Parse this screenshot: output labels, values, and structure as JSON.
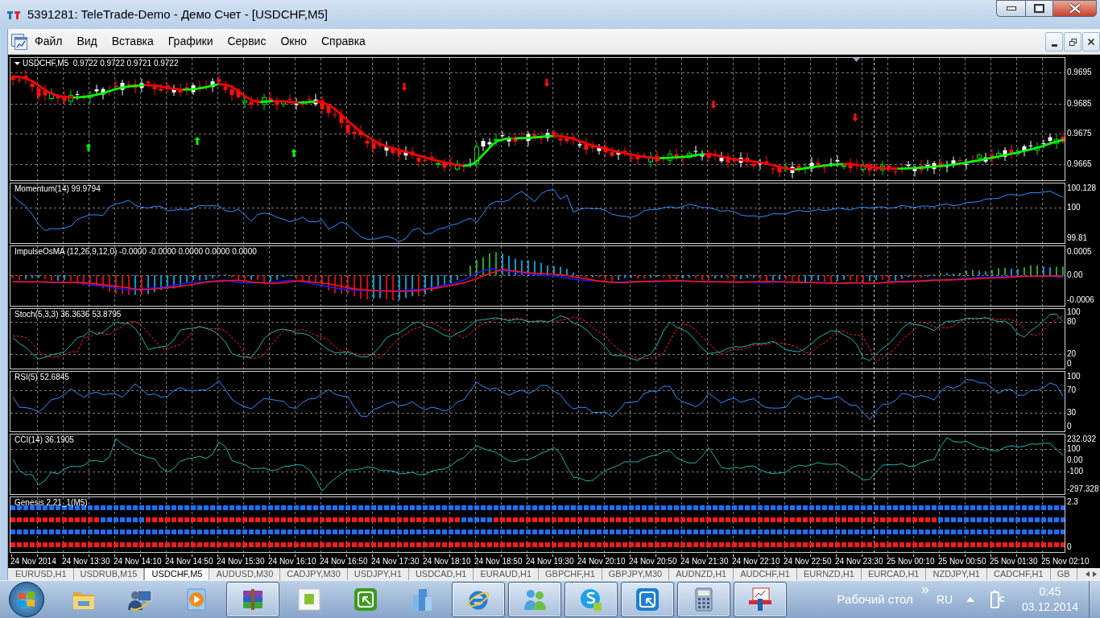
{
  "window": {
    "title": "5391281: TeleTrade-Demo - Демо Счет - [USDCHF,M5]"
  },
  "menu": [
    "Файл",
    "Вид",
    "Вставка",
    "Графики",
    "Сервис",
    "Окно",
    "Справка"
  ],
  "chart": {
    "panes": [
      {
        "kind": "candles",
        "legend": "USDCHF,M5  0.9722 0.9722 0.9721 0.9722",
        "axis_labels": [
          "0.9695",
          "0.9685",
          "0.9675",
          "0.9665"
        ]
      },
      {
        "kind": "line",
        "legend": "Momentum(14) 99.9794",
        "axis_labels": [
          "100.128",
          "100",
          "99.81"
        ]
      },
      {
        "kind": "histogram",
        "legend": "ImpulseOsMA (12,26,9,12,0) -0.0000 -0.0000 0.0000 0.0000 0.0000",
        "axis_labels": [
          "0.0005",
          "0.00",
          "-0.0006"
        ]
      },
      {
        "kind": "oscillator",
        "legend": "Stoch(5,3,3) 36.3636 53.8795",
        "axis_labels": [
          "100",
          "80",
          "20",
          "0"
        ]
      },
      {
        "kind": "line",
        "legend": "RSI(5) 52.6845",
        "axis_labels": [
          "100",
          "70",
          "30",
          "0"
        ]
      },
      {
        "kind": "line",
        "legend": "CCI(14) 36.1905",
        "axis_labels": [
          "232.032",
          "100",
          "0.00",
          "-100",
          "-297.328"
        ]
      },
      {
        "kind": "dots",
        "legend": "Genesis 2.21_1(M5)",
        "axis_labels": [
          "2.3",
          "0"
        ]
      }
    ],
    "time_labels": [
      "24 Nov 2014",
      "24 Nov 13:30",
      "24 Nov 14:10",
      "24 Nov 14:50",
      "24 Nov 15:30",
      "24 Nov 16:10",
      "24 Nov 16:50",
      "24 Nov 17:30",
      "24 Nov 18:10",
      "24 Nov 18:50",
      "24 Nov 19:30",
      "24 Nov 20:10",
      "24 Nov 20:50",
      "24 Nov 21:30",
      "24 Nov 22:10",
      "24 Nov 22:50",
      "24 Nov 23:30",
      "25 Nov 00:10",
      "25 Nov 00:50",
      "25 Nov 01:30",
      "25 Nov 02:10"
    ]
  },
  "tabs": [
    {
      "label": "EURUSD,H1",
      "selected": false
    },
    {
      "label": "USDRUB,M15",
      "selected": false
    },
    {
      "label": "USDCHF,M5",
      "selected": true
    },
    {
      "label": "AUDUSD,M30",
      "selected": false
    },
    {
      "label": "CADJPY,M30",
      "selected": false
    },
    {
      "label": "USDJPY,H1",
      "selected": false
    },
    {
      "label": "USDCAD,H1",
      "selected": false
    },
    {
      "label": "EURAUD,H1",
      "selected": false
    },
    {
      "label": "GBPCHF,H1",
      "selected": false
    },
    {
      "label": "GBPJPY,M30",
      "selected": false
    },
    {
      "label": "AUDNZD,H1",
      "selected": false
    },
    {
      "label": "AUDCHF,H1",
      "selected": false
    },
    {
      "label": "EURNZD,H1",
      "selected": false
    },
    {
      "label": "EURCAD,H1",
      "selected": false
    },
    {
      "label": "NZDJPY,H1",
      "selected": false
    },
    {
      "label": "CADCHF,H1",
      "selected": false
    },
    {
      "label": "GB",
      "selected": false
    }
  ],
  "taskbar": {
    "apps": [
      {
        "kind": "folder",
        "running": false
      },
      {
        "kind": "user",
        "running": false
      },
      {
        "kind": "player",
        "running": false
      },
      {
        "kind": "archive",
        "running": true
      },
      {
        "kind": "tile",
        "running": false
      },
      {
        "kind": "frame",
        "running": false
      },
      {
        "kind": "buildings",
        "running": false
      },
      {
        "kind": "browser",
        "running": true
      },
      {
        "kind": "messenger",
        "running": true
      },
      {
        "kind": "chat",
        "running": true
      },
      {
        "kind": "remote",
        "running": true
      },
      {
        "kind": "calculator",
        "running": true
      },
      {
        "kind": "terminal",
        "running": true
      }
    ],
    "desktop_label": "Рабочий стол",
    "language": "RU",
    "time": "0:45",
    "date": "03.12.2014"
  }
}
